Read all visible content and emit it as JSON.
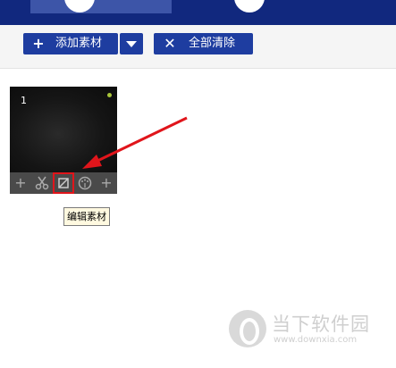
{
  "toolbar": {
    "add_label": "添加素材",
    "clear_label": "全部清除"
  },
  "clip": {
    "index": "1",
    "tools": [
      {
        "icon": "plus-icon"
      },
      {
        "icon": "scissors-icon"
      },
      {
        "icon": "crop-icon",
        "highlighted": true
      },
      {
        "icon": "palette-icon"
      },
      {
        "icon": "plus-icon"
      }
    ]
  },
  "tooltip": {
    "text": "编辑素材"
  },
  "watermark": {
    "name": "当下软件园",
    "url": "www.downxia.com"
  },
  "colors": {
    "header": "#11287e",
    "button": "#1e3da0",
    "highlight": "#e0151b"
  }
}
